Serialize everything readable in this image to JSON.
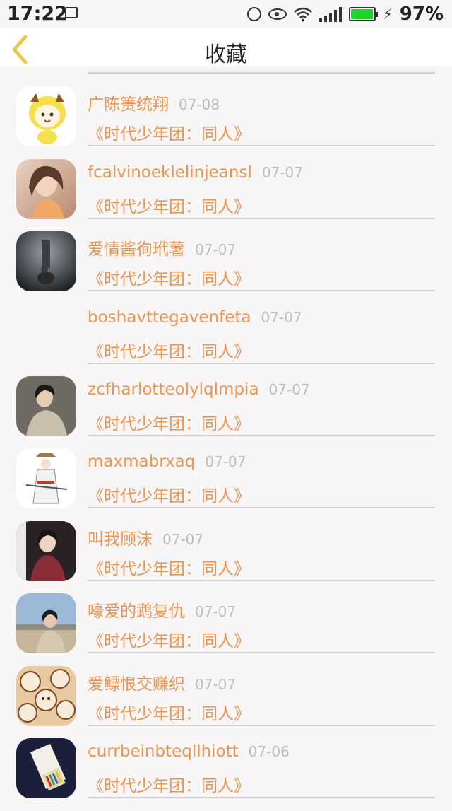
{
  "status_bar": {
    "time": "17:22",
    "battery_percent": "97%",
    "battery_level": 0.97,
    "icons": [
      "gallery-icon",
      "alarm-icon",
      "eye-icon",
      "wifi-icon",
      "signal-icon",
      "battery-icon",
      "charging-icon"
    ]
  },
  "header": {
    "title": "收藏",
    "back_icon": "chevron-left-icon",
    "accent_color": "#e6c84a"
  },
  "colors": {
    "name": "#e8954f",
    "date": "#bdbdbd",
    "background": "#f8f5f6"
  },
  "items": [
    {
      "name": "",
      "date": "",
      "title": "",
      "avatar": "cut-off"
    },
    {
      "name": "广陈箦统翔",
      "date": "07-08",
      "title": "《时代少年团：同人》",
      "avatar": "cartoon"
    },
    {
      "name": "fcalvinoeklelinjeansl",
      "date": "07-07",
      "title": "《时代少年团：同人》",
      "avatar": "photo"
    },
    {
      "name": "爱情酱徇玳薯",
      "date": "07-07",
      "title": "《时代少年团：同人》",
      "avatar": "photo"
    },
    {
      "name": "boshavttegavenfeta",
      "date": "07-07",
      "title": "《时代少年团：同人》",
      "avatar": "none"
    },
    {
      "name": "zcfharlotteolylqlmpia",
      "date": "07-07",
      "title": "《时代少年团：同人》",
      "avatar": "photo"
    },
    {
      "name": "maxmabrxaq",
      "date": "07-07",
      "title": "《时代少年团：同人》",
      "avatar": "illustration"
    },
    {
      "name": "叫我顾沫",
      "date": "07-07",
      "title": "《时代少年团：同人》",
      "avatar": "photo"
    },
    {
      "name": "嚎爱的鹉复仇",
      "date": "07-07",
      "title": "《时代少年团：同人》",
      "avatar": "photo"
    },
    {
      "name": "爱鳔恨交赚织",
      "date": "07-07",
      "title": "《时代少年团：同人》",
      "avatar": "illustration"
    },
    {
      "name": "currbeinbteqllhiott",
      "date": "07-06",
      "title": "《时代少年团：同人》",
      "avatar": "photo"
    }
  ]
}
